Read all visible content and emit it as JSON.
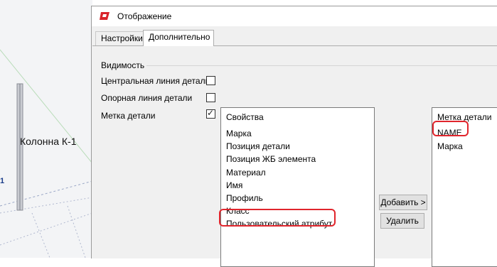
{
  "viewport": {
    "column_label": "Колонна К-1",
    "axis_mark": "1"
  },
  "dialog": {
    "title": "Отображение",
    "tabs": [
      {
        "label": "Настройки",
        "active": false
      },
      {
        "label": "Дополнительно",
        "active": true
      }
    ],
    "visibility": {
      "group_title": "Видимость",
      "rows": [
        {
          "label": "Центральная линия детали",
          "checked": false
        },
        {
          "label": "Опорная линия детали",
          "checked": false
        },
        {
          "label": "Метка детали",
          "checked": true
        }
      ]
    },
    "properties_list": {
      "header": "Свойства",
      "items": [
        "Марка",
        "Позиция детали",
        "Позиция ЖБ элемента",
        "Материал",
        "Имя",
        "Профиль",
        "Класс",
        "Пользовательский атрибут"
      ]
    },
    "buttons": {
      "add": "Добавить >",
      "remove": "Удалить"
    },
    "mark_list": {
      "header": "Метка детали",
      "items": [
        "NAME",
        "Марка"
      ]
    },
    "colors": {
      "highlight": "#e0252c",
      "app_icon": "#d9242b"
    }
  }
}
